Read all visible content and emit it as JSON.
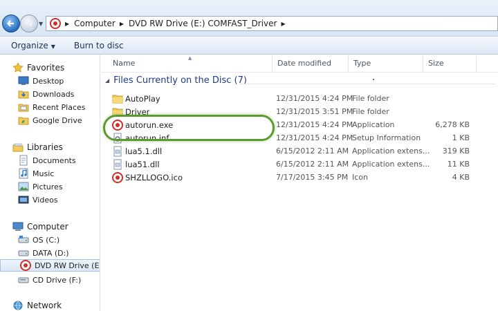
{
  "breadcrumb": [
    "Computer",
    "DVD RW Drive (E:) COMFAST_Driver"
  ],
  "toolbar": {
    "organize": "Organize",
    "burn": "Burn to disc"
  },
  "nav": {
    "favorites": "Favorites",
    "desktop": "Desktop",
    "downloads": "Downloads",
    "recent": "Recent Places",
    "gdrive": "Google Drive",
    "libraries": "Libraries",
    "documents": "Documents",
    "music": "Music",
    "pictures": "Pictures",
    "videos": "Videos",
    "computer": "Computer",
    "osc": "OS (C:)",
    "datad": "DATA (D:)",
    "dvde": "DVD RW Drive (E:) C",
    "cdf": "CD Drive (F:)",
    "network": "Network"
  },
  "columns": {
    "name": "Name",
    "date": "Date modified",
    "type": "Type",
    "size": "Size"
  },
  "group": {
    "label": "Files Currently on the Disc (7)"
  },
  "files": [
    {
      "name": "AutoPlay",
      "date": "12/31/2015 4:24 PM",
      "type": "File folder",
      "size": "",
      "icon": "folder-icon"
    },
    {
      "name": "Driver",
      "date": "12/31/2015 3:51 PM",
      "type": "File folder",
      "size": "",
      "icon": "folder-icon"
    },
    {
      "name": "autorun.exe",
      "date": "12/31/2015 4:24 PM",
      "type": "Application",
      "size": "6,278 KB",
      "icon": "app-logo-icon"
    },
    {
      "name": "autorun.inf",
      "date": "12/31/2015 4:24 PM",
      "type": "Setup Information",
      "size": "1 KB",
      "icon": "setup-file-icon"
    },
    {
      "name": "lua5.1.dll",
      "date": "6/15/2012 2:11 AM",
      "type": "Application extens...",
      "size": "319 KB",
      "icon": "dll-file-icon"
    },
    {
      "name": "lua51.dll",
      "date": "6/15/2012 2:11 AM",
      "type": "Application extens...",
      "size": "11 KB",
      "icon": "dll-file-icon"
    },
    {
      "name": "SHZLLOGO.ico",
      "date": "7/17/2015 3:45 PM",
      "type": "Icon",
      "size": "4 KB",
      "icon": "app-logo-icon"
    }
  ],
  "colors": {
    "accent": "#1e3b86",
    "highlight": "#5a9a2e",
    "selection": "#dbe8f7"
  }
}
